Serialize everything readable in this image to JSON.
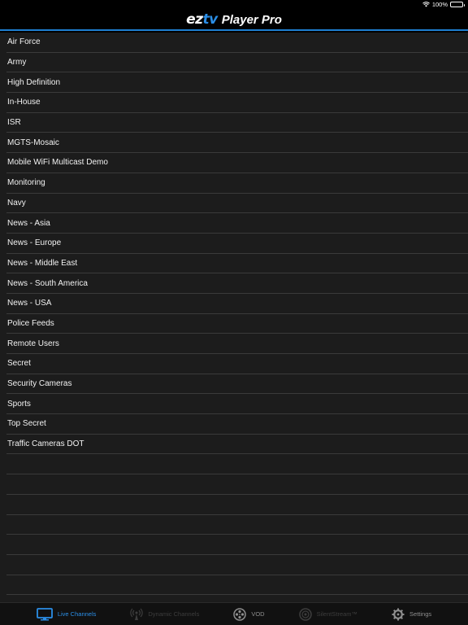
{
  "status_bar": {
    "battery_text": "100%"
  },
  "app": {
    "logo_ez": "ez",
    "logo_tv": "tv",
    "logo_rest": "Player Pro"
  },
  "channels": [
    "Air Force",
    "Army",
    "High Definition",
    "In-House",
    "ISR",
    "MGTS-Mosaic",
    "Mobile WiFi Multicast Demo",
    "Monitoring",
    "Navy",
    "News - Asia",
    "News - Europe",
    "News - Middle East",
    "News - South America",
    "News - USA",
    "Police Feeds",
    "Remote Users",
    "Secret",
    "Security Cameras",
    "Sports",
    "Top Secret",
    "Traffic Cameras DOT"
  ],
  "tabs": [
    {
      "label": "Live Channels",
      "icon": "tv-icon",
      "state": "active"
    },
    {
      "label": "Dynamic Channels",
      "icon": "broadcast-icon",
      "state": "disabled"
    },
    {
      "label": "VOD",
      "icon": "film-reel-icon",
      "state": "normal"
    },
    {
      "label": "SilentStream™",
      "icon": "silent-stream-icon",
      "state": "disabled"
    },
    {
      "label": "Settings",
      "icon": "gear-icon",
      "state": "normal"
    }
  ],
  "colors": {
    "accent": "#2b8ee6",
    "background": "#1c1c1c",
    "separator": "#3a3a3a"
  }
}
